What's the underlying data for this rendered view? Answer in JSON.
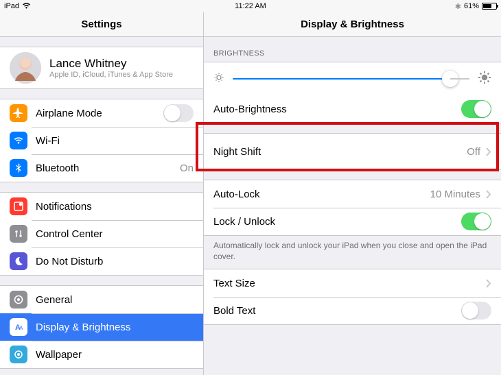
{
  "status": {
    "device": "iPad",
    "time": "11:22 AM",
    "battery_pct": "61%",
    "bt_glyph": "✱"
  },
  "left": {
    "title": "Settings",
    "profile": {
      "name": "Lance Whitney",
      "sub": "Apple ID, iCloud, iTunes & App Store"
    },
    "g1": {
      "airplane": "Airplane Mode",
      "wifi": "Wi-Fi",
      "bt": "Bluetooth",
      "bt_val": "On"
    },
    "g2": {
      "notifications": "Notifications",
      "control": "Control Center",
      "dnd": "Do Not Disturb"
    },
    "g3": {
      "general": "General",
      "display": "Display & Brightness",
      "wallpaper": "Wallpaper"
    }
  },
  "right": {
    "title": "Display & Brightness",
    "section_brightness": "BRIGHTNESS",
    "auto_brightness": "Auto-Brightness",
    "night_shift": "Night Shift",
    "night_shift_val": "Off",
    "auto_lock": "Auto-Lock",
    "auto_lock_val": "10 Minutes",
    "lock_unlock": "Lock / Unlock",
    "lock_footer": "Automatically lock and unlock your iPad when you close and open the iPad cover.",
    "text_size": "Text Size",
    "bold_text": "Bold Text"
  }
}
